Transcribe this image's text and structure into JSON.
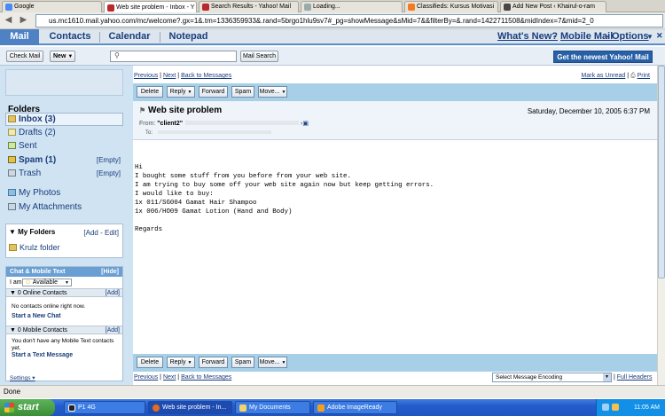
{
  "browser": {
    "tabs": [
      {
        "label": "Google",
        "icon": "google-favicon"
      },
      {
        "label": "Web site problem - Inbox - Y",
        "icon": "yahoo-favicon",
        "active": true
      },
      {
        "label": "Search Results - Yahoo! Mail",
        "icon": "yahoo-favicon"
      },
      {
        "label": "Loading...",
        "icon": "loading-favicon"
      },
      {
        "label": "Classifieds: Kursus Motivasi",
        "icon": "blogger-favicon"
      },
      {
        "label": "Add New Post ‹ Khairul-o-ram",
        "icon": "wordpress-favicon"
      }
    ],
    "url": "us.mc1610.mail.yahoo.com/mc/welcome?.gx=1&.tm=1336359933&.rand=5brgo1hlu9sv7#_pg=showMessage&sMid=7&&filterBy=&.rand=1422711508&midIndex=7&mid=2_0"
  },
  "yahoo_nav": {
    "tabs": [
      "Mail",
      "Contacts",
      "Calendar",
      "Notepad"
    ],
    "right_links": [
      "What's New?",
      "Mobile Mail",
      "Options"
    ],
    "sep": "-"
  },
  "toolbar": {
    "check_mail": "Check Mail",
    "new": "New",
    "search_button": "Mail Search",
    "newest": "Get the newest Yahoo! Mail"
  },
  "sidebar": {
    "folders_title": "Folders",
    "folders": [
      {
        "label": "Inbox",
        "count": "(3)",
        "bold": true
      },
      {
        "label": "Drafts",
        "count": "(2)",
        "bold": false
      },
      {
        "label": "Sent",
        "count": "",
        "bold": false
      },
      {
        "label": "Spam",
        "count": "(1)",
        "bold": true,
        "empty": "[Empty]"
      },
      {
        "label": "Trash",
        "count": "",
        "bold": false,
        "empty": "[Empty]"
      }
    ],
    "extras": [
      "My Photos",
      "My Attachments"
    ],
    "my_folders_title": "My Folders",
    "my_folders_actions": "[Add - Edit]",
    "my_folders": [
      "Krulz folder"
    ],
    "chat": {
      "title": "Chat & Mobile Text",
      "hide": "[Hide]",
      "i_am": "I am",
      "status": "Available",
      "online_header": "0 Online Contacts",
      "add": "[Add]",
      "no_contacts": "No contacts online right now.",
      "start_chat": "Start a New Chat",
      "mobile_header": "0 Mobile Contacts",
      "no_mobile": "You don't have any Mobile Text contacts yet.",
      "start_text": "Start a Text Message",
      "settings": "Settings"
    }
  },
  "message": {
    "nav": [
      "Previous",
      "Next",
      "Back to Messages"
    ],
    "mark_unread": "Mark as Unread",
    "print": "Print",
    "actions": [
      "Delete",
      "Reply",
      "Forward",
      "Spam",
      "Move..."
    ],
    "subject": "Web site problem",
    "date": "Saturday, December 10, 2005 6:37 PM",
    "from_label": "From:",
    "from_value": "\"client2\"",
    "to_label": "To:",
    "body": "Hi\nI bought some stuff from you before from your web site.\nI am trying to buy some off your web site again now but keep getting errors.\nI would like to buy:\n1x 011/SG004 Gamat Hair Shampoo\n1x 006/HO09 Gamat Lotion (Hand and Body)\n\nRegards",
    "encoding_select": "Select Message Encoding",
    "full_headers": "Full Headers"
  },
  "status_bar": "Done",
  "taskbar": {
    "start": "start",
    "tasks": [
      {
        "label": "P1 4G",
        "icon": "terminal-icon"
      },
      {
        "label": "Web site problem - In...",
        "icon": "firefox-icon",
        "active": true
      },
      {
        "label": "My Documents",
        "icon": "folder-icon"
      },
      {
        "label": "Adobe ImageReady",
        "icon": "imageready-icon"
      }
    ],
    "clock": "11:05 AM"
  },
  "colors": {
    "accent": "#4e82c5",
    "toolbar": "#a7cfe7",
    "sidebar": "#cfe3f2",
    "taskbar": "#245ccc"
  }
}
